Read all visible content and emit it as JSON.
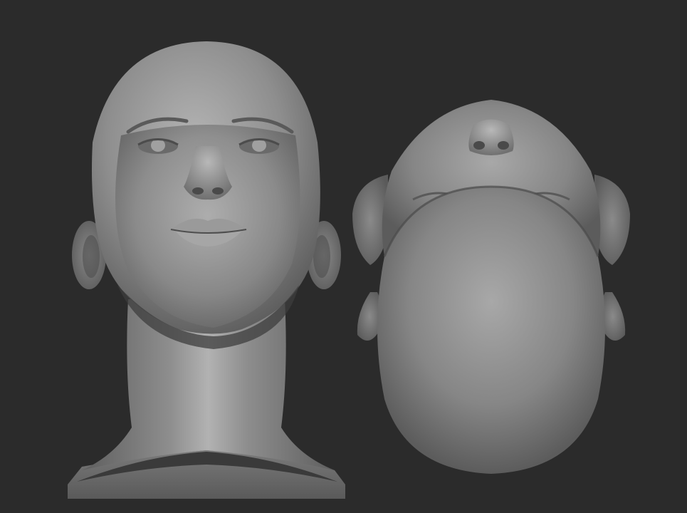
{
  "scene": {
    "background_color": "#2b2b2b",
    "material_color": "#8c8c8c",
    "views": [
      {
        "view": "front",
        "subject": "sculpted-head-bust"
      },
      {
        "view": "bottom",
        "subject": "sculpted-head-underside"
      }
    ]
  }
}
